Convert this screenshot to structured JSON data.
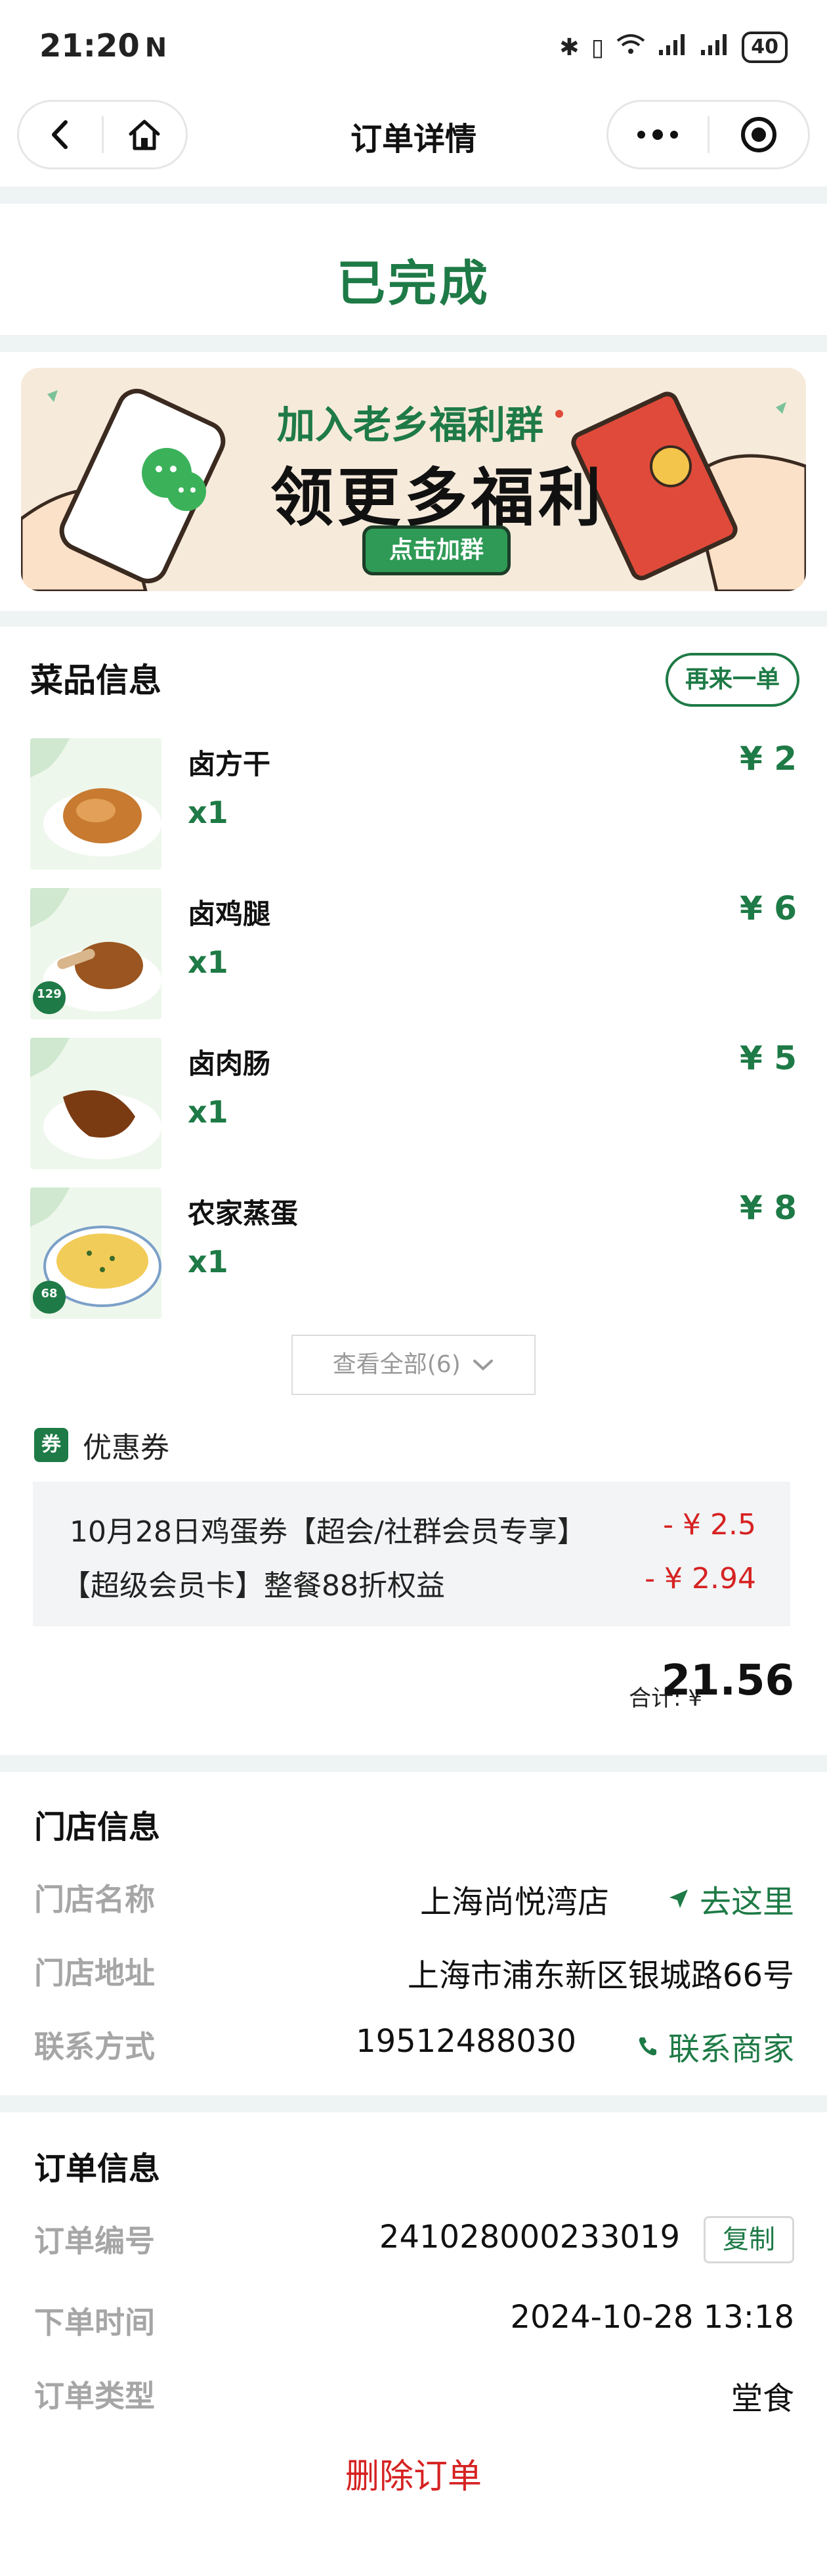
{
  "status_bar": {
    "time": "21:20",
    "nfc": "N",
    "icons": [
      "bluetooth-icon",
      "vibrate-icon",
      "wifi-icon",
      "signal-icon",
      "signal-icon"
    ],
    "battery": "40"
  },
  "nav": {
    "title": "订单详情"
  },
  "order_status": "已完成",
  "banner": {
    "line1": "加入老乡福利群",
    "line2": "领更多福利",
    "button": "点击加群"
  },
  "dishes": {
    "title": "菜品信息",
    "reorder": "再来一单",
    "items": [
      {
        "name": "卤方干",
        "qty": "x1",
        "price": "¥ 2",
        "badge": ""
      },
      {
        "name": "卤鸡腿",
        "qty": "x1",
        "price": "¥ 6",
        "badge": "129"
      },
      {
        "name": "卤肉肠",
        "qty": "x1",
        "price": "¥ 5",
        "badge": ""
      },
      {
        "name": "农家蒸蛋",
        "qty": "x1",
        "price": "¥ 8",
        "badge": "68"
      }
    ],
    "view_all": "查看全部(6)"
  },
  "coupons": {
    "icon_label": "券",
    "title": "优惠券",
    "items": [
      {
        "label": "10月28日鸡蛋券【超会/社群会员专享】",
        "amount": "- ¥ 2.5"
      },
      {
        "label": "【超级会员卡】整餐88折权益",
        "amount": "- ¥ 2.94"
      }
    ]
  },
  "total": {
    "label": "合计: ¥",
    "value": "21.56"
  },
  "store": {
    "title": "门店信息",
    "name_label": "门店名称",
    "name": "上海尚悦湾店",
    "go_label": "去这里",
    "address_label": "门店地址",
    "address": "上海市浦东新区银城路66号",
    "contact_label": "联系方式",
    "phone": "19512488030",
    "contact_link": "联系商家"
  },
  "order": {
    "title": "订单信息",
    "number_label": "订单编号",
    "number": "241028000233019",
    "copy": "复制",
    "time_label": "下单时间",
    "time": "2024-10-28 13:18",
    "type_label": "订单类型",
    "type": "堂食",
    "delete": "删除订单"
  },
  "colors": {
    "brand_green": "#1e7a46",
    "discount_red": "#d62222",
    "section_gap": "#eef3f4"
  }
}
